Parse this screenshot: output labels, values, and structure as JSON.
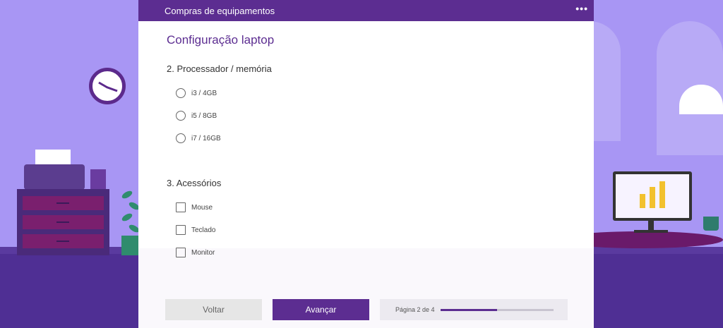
{
  "header": {
    "title": "Compras de equipamentos",
    "more_label": "•••"
  },
  "form": {
    "heading": "Configuração laptop",
    "questions": [
      {
        "title": "2. Processador / memória",
        "type": "radio",
        "options": [
          "i3 / 4GB",
          "i5 / 8GB",
          "i7 / 16GB"
        ]
      },
      {
        "title": "3. Acessórios",
        "type": "checkbox",
        "options": [
          "Mouse",
          "Teclado",
          "Monitor"
        ]
      }
    ]
  },
  "footer": {
    "back_label": "Voltar",
    "next_label": "Avançar",
    "progress_text": "Página 2 de 4",
    "progress_fraction": 0.5
  },
  "colors": {
    "accent": "#5c2d91",
    "background": "#a997f5"
  }
}
